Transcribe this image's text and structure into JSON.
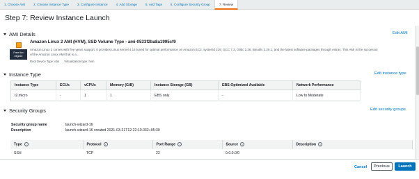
{
  "wizard": {
    "tabs": [
      {
        "label": "1. Choose AMI"
      },
      {
        "label": "2. Choose Instance Type"
      },
      {
        "label": "3. Configure Instance"
      },
      {
        "label": "4. Add Storage"
      },
      {
        "label": "5. Add Tags"
      },
      {
        "label": "6. Configure Security Group"
      },
      {
        "label": "7. Review"
      }
    ],
    "active_tab_index": 6
  },
  "page": {
    "title": "Step 7: Review Instance Launch"
  },
  "ami": {
    "heading": "AMI Details",
    "edit_label": "Edit AMI",
    "name": "Amazon Linux 2 AMI (HVM), SSD Volume Type - ami-0533f2ba8a1995cf9",
    "description": "Amazon Linux 2 comes with five years support. It provides Linux kernel 4.14 tuned for optimal performance on Amazon EC2, systemd 219, GCC 7.3, Glibc 2.26, Binutils 2.29.1, and the latest software packages through extras. This AMI is the successor of the Amazon Linux AMI that is a...",
    "root_device": "Root Device Type: ebs",
    "virtualization": "Virtualization type: hvm",
    "badge_line1": "Free tier",
    "badge_line2": "eligible"
  },
  "instance_type": {
    "heading": "Instance Type",
    "edit_label": "Edit instance type",
    "columns": [
      "Instance Type",
      "ECUs",
      "vCPUs",
      "Memory (GiB)",
      "Instance Storage (GB)",
      "EBS-Optimized Available",
      "Network Performance"
    ],
    "row": [
      "t2.micro",
      "-",
      "1",
      "1",
      "EBS only",
      "-",
      "Low to Moderate"
    ]
  },
  "security_groups": {
    "heading": "Security Groups",
    "edit_label": "Edit security groups",
    "name_label": "Security group name",
    "name_value": "launch-wizard-16",
    "desc_label": "Description",
    "desc_value": "launch-wizard-16 created 2021-03-21T12:22:10.032+05:30",
    "rules_columns": [
      "Type",
      "Protocol",
      "Port Range",
      "Source",
      "Description"
    ],
    "rules_row": [
      "SSH",
      "TCP",
      "22",
      "0.0.0.0/0",
      ""
    ]
  },
  "footer": {
    "cancel_label": "Cancel",
    "previous_label": "Previous",
    "launch_label": "Launch"
  },
  "colors": {
    "link": "#0073bb",
    "primary_button": "#0073bb",
    "active_tab_underline": "#ec7211",
    "badge_bg": "#232f3e"
  }
}
